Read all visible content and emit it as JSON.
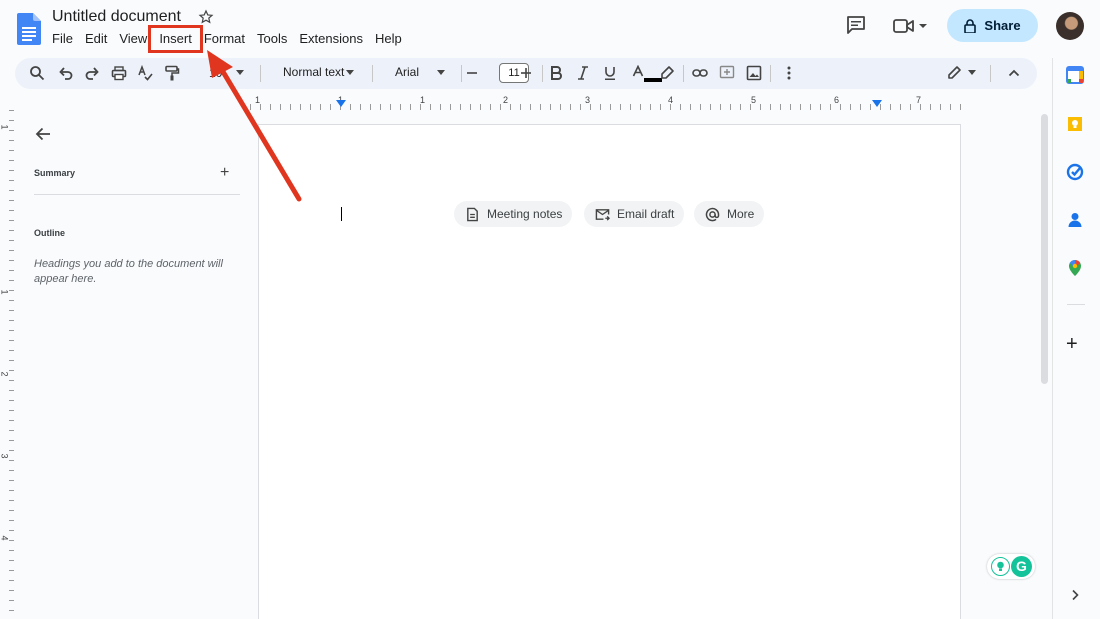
{
  "window": {
    "doc_title": "Untitled document"
  },
  "menu": {
    "items": [
      "File",
      "Edit",
      "View",
      "Insert",
      "Format",
      "Tools",
      "Extensions",
      "Help"
    ],
    "highlighted": "Insert"
  },
  "header": {
    "share_label": "Share"
  },
  "toolbar": {
    "zoom": "10",
    "paragraph_style": "Normal text",
    "font": "Arial",
    "font_size": "11"
  },
  "ruler": {
    "numbers": [
      "1",
      "1",
      "1",
      "2",
      "3",
      "4",
      "5",
      "6",
      "7"
    ],
    "vertical_numbers": [
      "1",
      "1",
      "2",
      "3",
      "4"
    ]
  },
  "outline_panel": {
    "summary_label": "Summary",
    "outline_label": "Outline",
    "hint": "Headings you add to the document will appear here."
  },
  "chips": {
    "meeting_notes": "Meeting notes",
    "email_draft": "Email draft",
    "more": "More"
  },
  "grammarly": {
    "logo_letter": "G"
  },
  "colors": {
    "share_bg": "#c2e7ff",
    "annotation": "#e0361f",
    "docs_blue": "#4285f4"
  },
  "icons": {
    "doc": "docs-logo-icon",
    "star": "star-icon",
    "comment": "comment-icon",
    "meet": "meet-icon",
    "lock": "lock-icon",
    "search": "search-icon",
    "undo": "undo-icon",
    "redo": "redo-icon",
    "print": "print-icon",
    "spell": "spellcheck-icon",
    "paint": "paint-format-icon",
    "bold": "bold-icon",
    "italic": "italic-icon",
    "underline": "underline-icon",
    "text_color": "text-color-icon",
    "highlight": "highlight-icon",
    "link": "link-icon",
    "add_comment": "add-comment-icon",
    "image": "image-icon",
    "more": "more-vert-icon",
    "pencil": "editing-mode-icon",
    "collapse": "chevron-up-icon",
    "calendar": "calendar-icon",
    "keep": "keep-icon",
    "tasks": "tasks-icon",
    "contacts": "contacts-icon",
    "maps": "maps-icon"
  }
}
